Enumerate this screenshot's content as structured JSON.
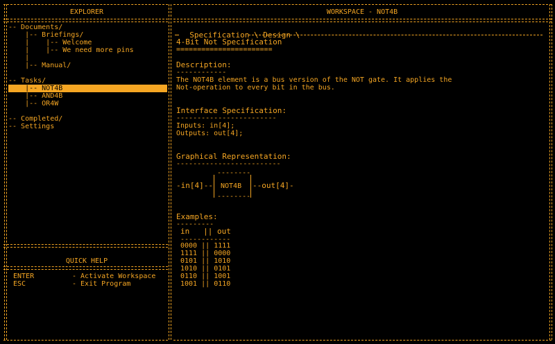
{
  "explorer": {
    "title": "EXPLORER",
    "tree": [
      "-- Documents/",
      "    |-- Briefings/",
      "    |    |-- Welcome",
      "    |    |-- We need more pins",
      "    |",
      "    |-- Manual/",
      "",
      "-- Tasks/",
      "    |-- NOT4B",
      "    |-- AND4B",
      "    |-- OR4W",
      "",
      "-- Completed/",
      "-- Settings"
    ],
    "selected_index": 8
  },
  "quick_help": {
    "title": "QUICK HELP",
    "rows": [
      {
        "key": "ENTER",
        "desc": "- Activate Workspace"
      },
      {
        "key": "ESC",
        "desc": "- Exit Program"
      }
    ]
  },
  "workspace": {
    "title": "WORKSPACE - NOT4B",
    "tab_spec": "Specification",
    "tab_sep": "\\",
    "tab_design": "Design",
    "tab_end": "\\",
    "heading": "4-Bit Not Specification",
    "heading_underline": "=======================",
    "description_label": "Description:",
    "description_underline": "------------",
    "description_text": [
      "The NOT4B element is a bus version of the NOT gate. It applies the",
      "Not-operation to every bit in the bus."
    ],
    "interface_label": "Interface Specification:",
    "interface_underline": "------------------------",
    "inputs": "Inputs: in[4];",
    "outputs": "Outputs: out[4];",
    "graphical_label": "Graphical Representation:",
    "graphical_underline": "-------------------------",
    "diagram": {
      "top": "--------",
      "in_label": "-in[4]--",
      "box_label": "NOT4B",
      "out_label": "--out[4]-",
      "bottom": "--------"
    },
    "examples_label": "Examples:",
    "examples_underline": "---------",
    "table": {
      "header_in": "in",
      "header_sep": "||",
      "header_out": "out",
      "header_rule": "------------",
      "rows": [
        {
          "in": "0000",
          "out": "1111"
        },
        {
          "in": "1111",
          "out": "0000"
        },
        {
          "in": "0101",
          "out": "1010"
        },
        {
          "in": "1010",
          "out": "0101"
        },
        {
          "in": "0110",
          "out": "1001"
        },
        {
          "in": "1001",
          "out": "0110"
        }
      ]
    }
  }
}
